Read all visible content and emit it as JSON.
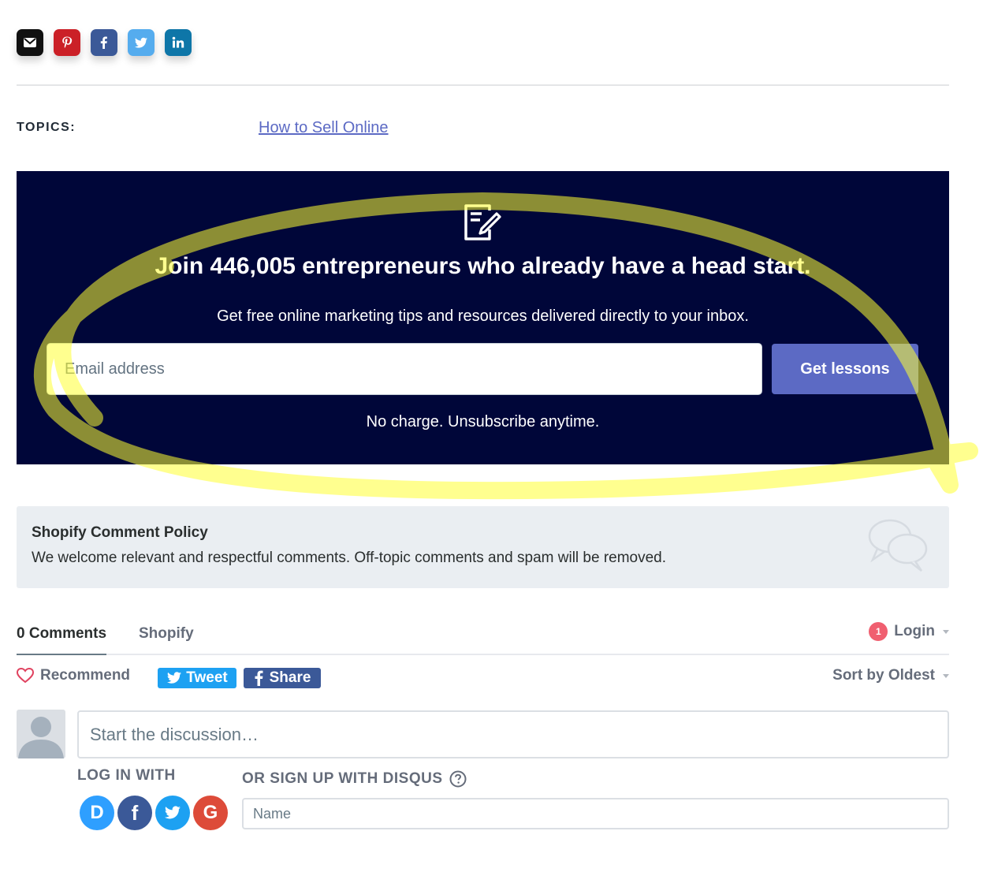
{
  "share": {
    "items": [
      {
        "icon": "email-icon",
        "color": "#111111"
      },
      {
        "icon": "pinterest-icon",
        "color": "#cb2027"
      },
      {
        "icon": "facebook-icon",
        "color": "#3b5998"
      },
      {
        "icon": "twitter-icon",
        "color": "#55acee"
      },
      {
        "icon": "linkedin-icon",
        "color": "#0e76a8"
      }
    ]
  },
  "topics": {
    "label": "TOPICS:",
    "link": "How to Sell Online"
  },
  "newsletter": {
    "icon": "edit-document-icon",
    "title": "Join 446,005 entrepreneurs who already have a head start.",
    "subtitle": "Get free online marketing tips and resources delivered directly to your inbox.",
    "email_placeholder": "Email address",
    "button_label": "Get lessons",
    "note": "No charge. Unsubscribe anytime.",
    "background": "#000639",
    "button_color": "#5c6ac4",
    "highlight_color": "#ffff00"
  },
  "policy": {
    "title": "Shopify Comment Policy",
    "text": "We welcome relevant and respectful comments. Off-topic comments and spam will be removed.",
    "icon": "speech-bubbles-icon"
  },
  "comments": {
    "count_label": "0 Comments",
    "forum_label": "Shopify",
    "login_badge": "1",
    "login_label": "Login",
    "recommend_label": "Recommend",
    "tweet_label": "Tweet",
    "share_label": "Share",
    "sort_label": "Sort by Oldest",
    "discussion_placeholder": "Start the discussion…",
    "login_with": "LOG IN WITH",
    "signup_with": "OR SIGN UP WITH DISQUS",
    "name_placeholder": "Name",
    "social": [
      {
        "label": "D",
        "icon": "disqus-icon",
        "color": "#2e9fff"
      },
      {
        "label": "f",
        "icon": "facebook-icon",
        "color": "#3b5998"
      },
      {
        "label": "t",
        "icon": "twitter-icon",
        "color": "#1da1f2"
      },
      {
        "label": "G",
        "icon": "google-icon",
        "color": "#dd4b39"
      }
    ]
  }
}
